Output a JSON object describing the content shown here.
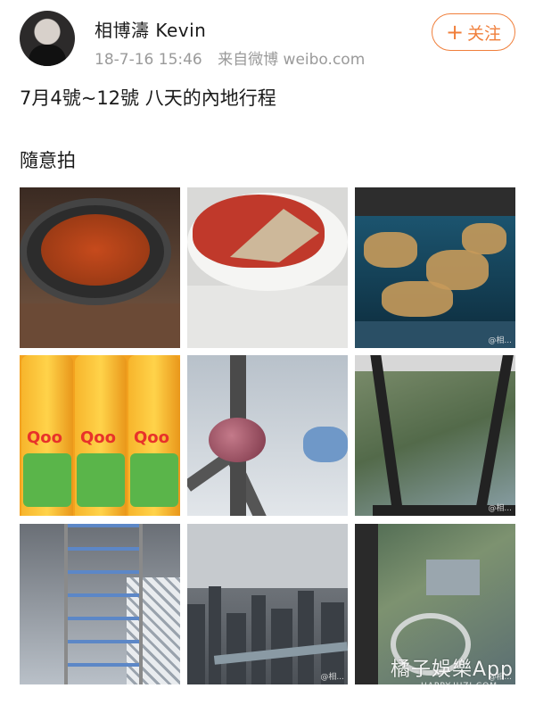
{
  "header": {
    "username": "相博濤 Kevin",
    "timestamp": "18-7-16 15:46",
    "source": "来自微博 weibo.com",
    "follow_label": "关注",
    "follow_icon": "plus-icon"
  },
  "post": {
    "text": "7月4號~12號 八天的內地行程",
    "subtext": "隨意拍"
  },
  "photos": [
    {
      "name": "crab-pan-photo"
    },
    {
      "name": "red-dome-dish-photo"
    },
    {
      "name": "crabs-in-tank-photo",
      "watermark": "@相..."
    },
    {
      "name": "qoo-bottles-photo",
      "label_text": "Qoo"
    },
    {
      "name": "tv-tower-photo"
    },
    {
      "name": "glass-floor-view-photo",
      "watermark": "@相..."
    },
    {
      "name": "spiral-elevator-photo"
    },
    {
      "name": "cityscape-photo",
      "watermark": "@相..."
    },
    {
      "name": "looking-down-photo",
      "watermark": "@相..."
    }
  ],
  "watermark": {
    "site": "橘子娛樂App",
    "url": "HAPPY.JUZI.COM"
  },
  "colors": {
    "accent": "#f07f3b",
    "meta_text": "#9a9a9a"
  }
}
